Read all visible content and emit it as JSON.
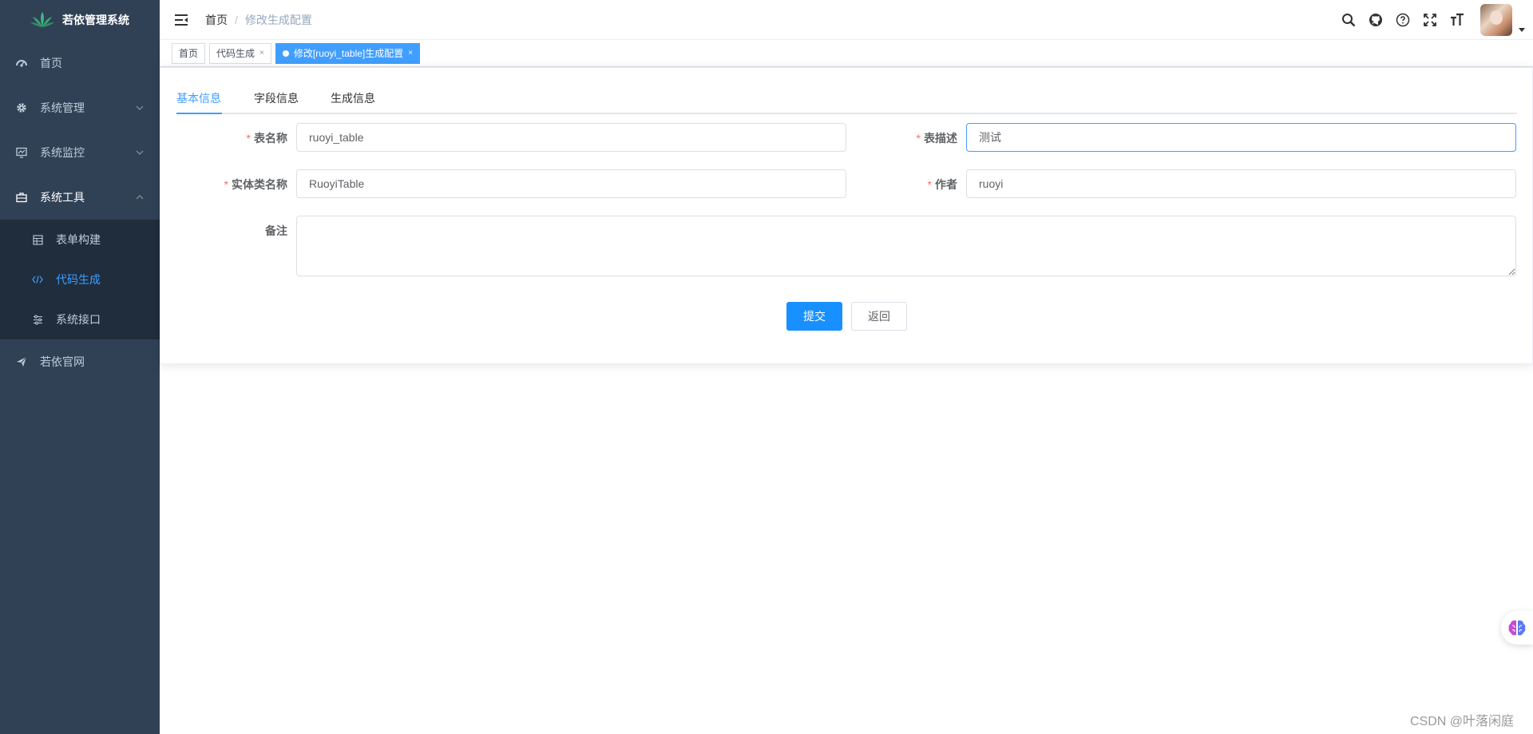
{
  "app": {
    "title": "若依管理系统"
  },
  "sidebar": {
    "items": [
      {
        "label": "首页",
        "icon": "dashboard-icon"
      },
      {
        "label": "系统管理",
        "icon": "gear-icon"
      },
      {
        "label": "系统监控",
        "icon": "monitor-icon"
      },
      {
        "label": "系统工具",
        "icon": "toolbox-icon",
        "expanded": true
      },
      {
        "label": "若依官网",
        "icon": "send-icon"
      }
    ],
    "tools_submenu": [
      {
        "label": "表单构建",
        "icon": "table-icon"
      },
      {
        "label": "代码生成",
        "icon": "code-icon",
        "active": true
      },
      {
        "label": "系统接口",
        "icon": "sliders-icon"
      }
    ]
  },
  "header": {
    "breadcrumb": {
      "home": "首页",
      "separator": "/",
      "current": "修改生成配置"
    },
    "icons": [
      "search-icon",
      "github-icon",
      "help-icon",
      "fullscreen-icon",
      "font-size-icon"
    ]
  },
  "tags": [
    {
      "label": "首页",
      "closable": false
    },
    {
      "label": "代码生成",
      "closable": true,
      "close": "×"
    },
    {
      "label": "修改[ruoyi_table]生成配置",
      "closable": true,
      "active": true,
      "close": "×"
    }
  ],
  "tabs": [
    {
      "label": "基本信息",
      "active": true
    },
    {
      "label": "字段信息"
    },
    {
      "label": "生成信息"
    }
  ],
  "form": {
    "required_mark": "*",
    "table_name": {
      "label": "表名称",
      "value": "ruoyi_table"
    },
    "table_comment": {
      "label": "表描述",
      "value": "测试"
    },
    "class_name": {
      "label": "实体类名称",
      "value": "RuoyiTable"
    },
    "function_author": {
      "label": "作者",
      "value": "ruoyi"
    },
    "remark": {
      "label": "备注",
      "value": ""
    },
    "submit_label": "提交",
    "back_label": "返回"
  },
  "colors": {
    "accent": "#409eff",
    "primary_button": "#1890ff",
    "sidebar_bg": "#304156",
    "submenu_bg": "#1f2d3d",
    "required": "#f56c6c"
  },
  "watermark": "CSDN @叶落闲庭"
}
